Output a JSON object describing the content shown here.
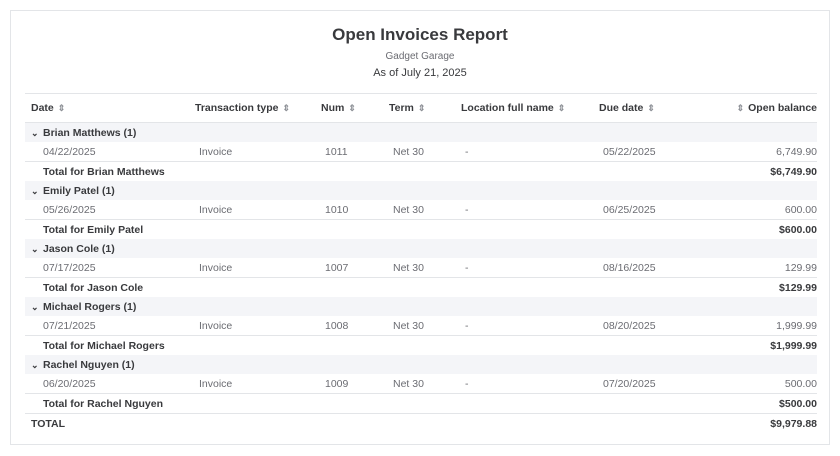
{
  "report": {
    "title": "Open Invoices Report",
    "company": "Gadget Garage",
    "as_of": "As of July 21, 2025"
  },
  "columns": {
    "date": "Date",
    "type": "Transaction type",
    "num": "Num",
    "term": "Term",
    "location": "Location full name",
    "due": "Due date",
    "balance": "Open balance"
  },
  "groups": [
    {
      "name": "Brian Matthews (1)",
      "date": "04/22/2025",
      "type": "Invoice",
      "num": "1011",
      "term": "Net 30",
      "location": "-",
      "due": "05/22/2025",
      "balance": "6,749.90",
      "total_label": "Total for Brian Matthews",
      "total": "$6,749.90"
    },
    {
      "name": "Emily Patel (1)",
      "date": "05/26/2025",
      "type": "Invoice",
      "num": "1010",
      "term": "Net 30",
      "location": "-",
      "due": "06/25/2025",
      "balance": "600.00",
      "total_label": "Total for Emily Patel",
      "total": "$600.00"
    },
    {
      "name": "Jason Cole (1)",
      "date": "07/17/2025",
      "type": "Invoice",
      "num": "1007",
      "term": "Net 30",
      "location": "-",
      "due": "08/16/2025",
      "balance": "129.99",
      "total_label": "Total for Jason Cole",
      "total": "$129.99"
    },
    {
      "name": "Michael Rogers (1)",
      "date": "07/21/2025",
      "type": "Invoice",
      "num": "1008",
      "term": "Net 30",
      "location": "-",
      "due": "08/20/2025",
      "balance": "1,999.99",
      "total_label": "Total for Michael Rogers",
      "total": "$1,999.99"
    },
    {
      "name": "Rachel Nguyen (1)",
      "date": "06/20/2025",
      "type": "Invoice",
      "num": "1009",
      "term": "Net 30",
      "location": "-",
      "due": "07/20/2025",
      "balance": "500.00",
      "total_label": "Total for Rachel Nguyen",
      "total": "$500.00"
    }
  ],
  "grand_total": {
    "label": "TOTAL",
    "value": "$9,979.88"
  },
  "icons": {
    "sort": "sort-icon",
    "chevron": "chevron-down-icon"
  }
}
